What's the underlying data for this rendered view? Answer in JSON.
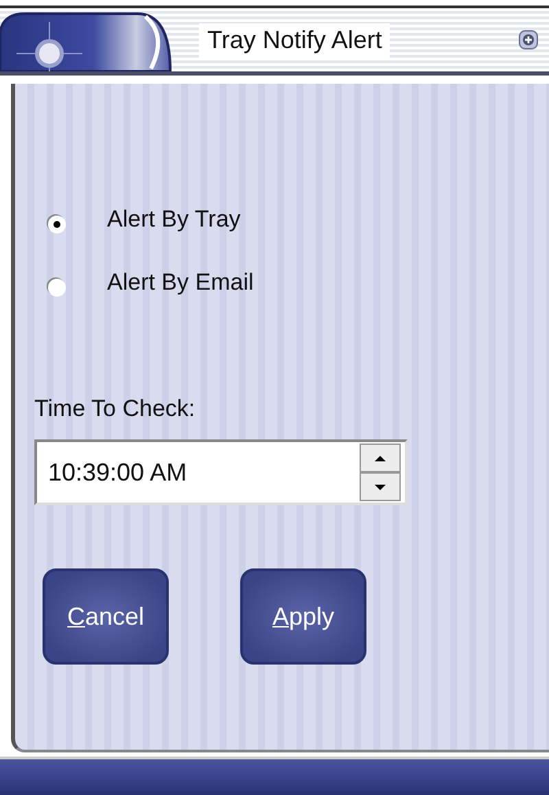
{
  "window": {
    "title": "Tray Notify Alert"
  },
  "alert_options": [
    {
      "label": "Alert By Tray",
      "selected": true
    },
    {
      "label": "Alert By Email",
      "selected": false
    }
  ],
  "time_field": {
    "label": "Time To Check:",
    "value": "10:39:00 AM"
  },
  "buttons": [
    {
      "label": "Cancel"
    },
    {
      "label": "Apply"
    }
  ]
}
